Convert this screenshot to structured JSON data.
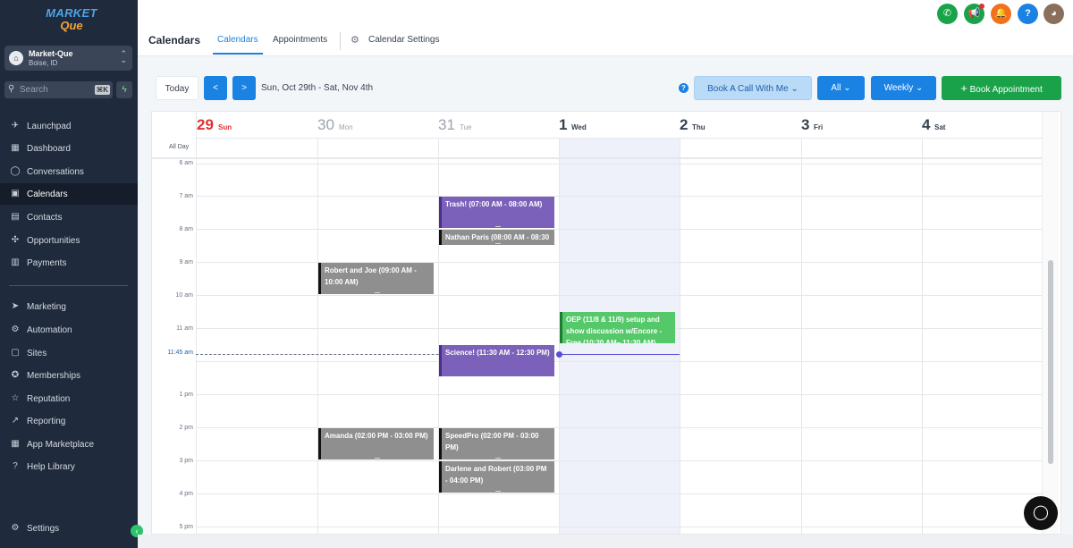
{
  "sidebar": {
    "logo": {
      "line1": "MARKET",
      "line2": "Que"
    },
    "account": {
      "name": "Market-Que",
      "location": "Boise, ID"
    },
    "search": {
      "placeholder": "Search",
      "shortcut": "⌘K"
    },
    "items": [
      {
        "label": "Launchpad",
        "icon": "rocket-icon"
      },
      {
        "label": "Dashboard",
        "icon": "dashboard-icon"
      },
      {
        "label": "Conversations",
        "icon": "chat-icon"
      },
      {
        "label": "Calendars",
        "icon": "calendar-icon"
      },
      {
        "label": "Contacts",
        "icon": "contacts-icon"
      },
      {
        "label": "Opportunities",
        "icon": "opportunities-icon"
      },
      {
        "label": "Payments",
        "icon": "payments-icon"
      },
      {
        "label": "Marketing",
        "icon": "send-icon"
      },
      {
        "label": "Automation",
        "icon": "automation-icon"
      },
      {
        "label": "Sites",
        "icon": "sites-icon"
      },
      {
        "label": "Memberships",
        "icon": "award-icon"
      },
      {
        "label": "Reputation",
        "icon": "star-icon"
      },
      {
        "label": "Reporting",
        "icon": "trend-icon"
      },
      {
        "label": "App Marketplace",
        "icon": "grid-icon"
      },
      {
        "label": "Help Library",
        "icon": "help-icon"
      }
    ],
    "settings_label": "Settings"
  },
  "header": {
    "title": "Calendars",
    "tabs": [
      {
        "label": "Calendars"
      },
      {
        "label": "Appointments"
      },
      {
        "label": "Calendar Settings"
      }
    ],
    "colors": {
      "phone": "#19a34a",
      "megaphone": "#1aa24a",
      "bell": "#f2711c",
      "help": "#1a82e2"
    }
  },
  "toolbar": {
    "today_label": "Today",
    "prev_label": "<",
    "next_label": ">",
    "date_range": "Sun, Oct 29th - Sat, Nov 4th",
    "book_call_label": "Book A Call With Me",
    "filter_label": "All",
    "view_label": "Weekly",
    "book_appointment_label": "Book Appointment"
  },
  "calendar": {
    "all_day_label": "All Day",
    "days": [
      {
        "num": "29",
        "dow": "Sun"
      },
      {
        "num": "30",
        "dow": "Mon"
      },
      {
        "num": "31",
        "dow": "Tue"
      },
      {
        "num": "1",
        "dow": "Wed"
      },
      {
        "num": "2",
        "dow": "Thu"
      },
      {
        "num": "3",
        "dow": "Fri"
      },
      {
        "num": "4",
        "dow": "Sat"
      }
    ],
    "hours": [
      "6 am",
      "7 am",
      "8 am",
      "9 am",
      "10 am",
      "11 am",
      "1 pm",
      "2 pm",
      "3 pm",
      "4 pm",
      "5 pm"
    ],
    "now_label": "11:45 am",
    "events": [
      {
        "title": "Trash! (07:00 AM - 08:00 AM)",
        "color": "purple"
      },
      {
        "title": "Nathan Paris (08:00 AM - 08:30",
        "color": "gray"
      },
      {
        "title": "Robert and Joe (09:00 AM - 10:00 AM)",
        "color": "gray"
      },
      {
        "title": "OEP (11/8 & 11/9) setup and show discussion w/Encore - Free (10:30 AM– 11:30 AM)",
        "color": "green"
      },
      {
        "title": "Science! (11:30 AM - 12:30 PM)",
        "color": "purple"
      },
      {
        "title": "Amanda (02:00 PM - 03:00 PM)",
        "color": "gray"
      },
      {
        "title": "SpeedPro (02:00 PM - 03:00 PM)",
        "color": "gray"
      },
      {
        "title": "Darlene and Robert (03:00 PM - 04:00 PM)",
        "color": "gray"
      }
    ]
  }
}
